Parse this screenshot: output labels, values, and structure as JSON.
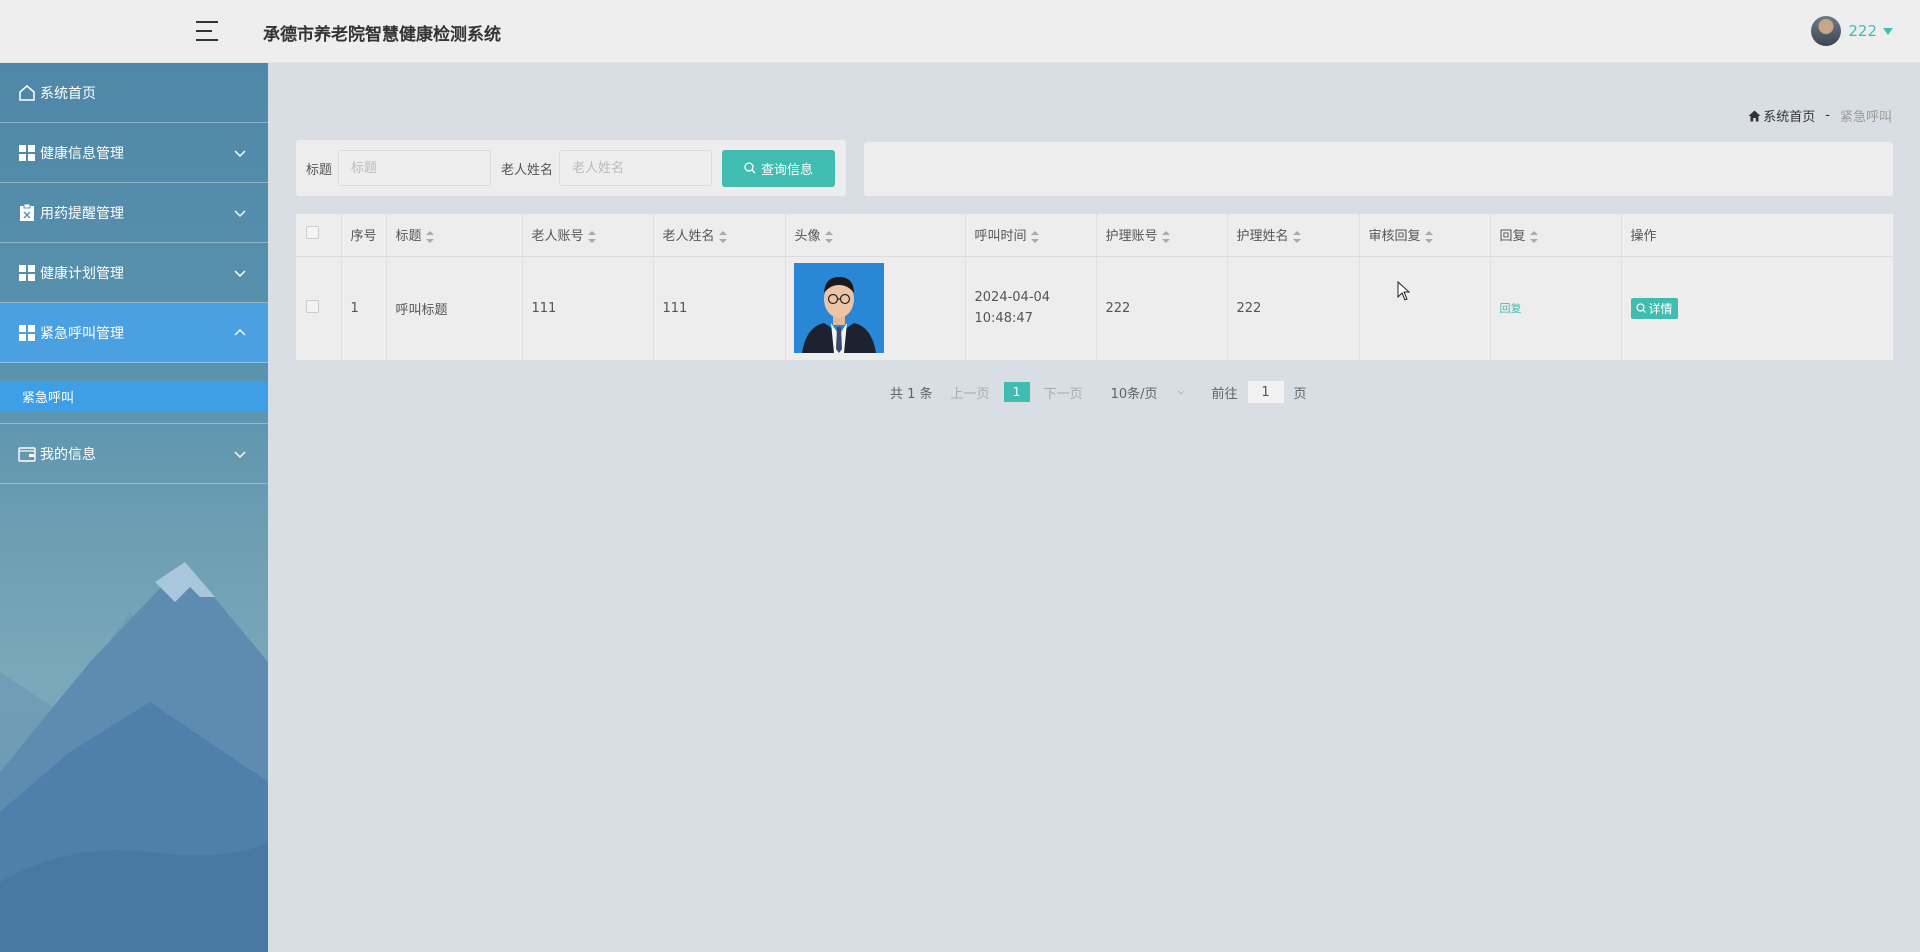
{
  "header": {
    "title": "承德市养老院智慧健康检测系统",
    "username": "222"
  },
  "sidebar": {
    "items": [
      {
        "label": "系统首页",
        "icon": "home-icon"
      },
      {
        "label": "健康信息管理",
        "icon": "grid-icon"
      },
      {
        "label": "用药提醒管理",
        "icon": "clipboard-icon"
      },
      {
        "label": "健康计划管理",
        "icon": "grid-icon"
      },
      {
        "label": "紧急呼叫管理",
        "icon": "grid-icon",
        "expanded": true
      },
      {
        "label": "我的信息",
        "icon": "wallet-icon"
      }
    ],
    "subitem": "紧急呼叫"
  },
  "breadcrumb": {
    "home": "系统首页",
    "separator": "-",
    "current": "紧急呼叫"
  },
  "search": {
    "title_label": "标题",
    "title_placeholder": "标题",
    "name_label": "老人姓名",
    "name_placeholder": "老人姓名",
    "button": "查询信息"
  },
  "table": {
    "headers": [
      "序号",
      "标题",
      "老人账号",
      "老人姓名",
      "头像",
      "呼叫时间",
      "护理账号",
      "护理姓名",
      "审核回复",
      "回复",
      "操作"
    ],
    "rows": [
      {
        "index": "1",
        "title": "呼叫标题",
        "elder_account": "111",
        "elder_name": "111",
        "call_time": "2024-04-04 10:48:47",
        "nurse_account": "222",
        "nurse_name": "222",
        "review_reply": "",
        "reply": "回复",
        "action": "详情"
      }
    ]
  },
  "pagination": {
    "total": "共 1 条",
    "prev": "上一页",
    "current": "1",
    "next": "下一页",
    "page_size": "10条/页",
    "goto_label": "前往",
    "goto_value": "1",
    "goto_suffix": "页"
  },
  "colors": {
    "accent": "#40bcb0",
    "sidebar_active": "#4aa0e0"
  }
}
